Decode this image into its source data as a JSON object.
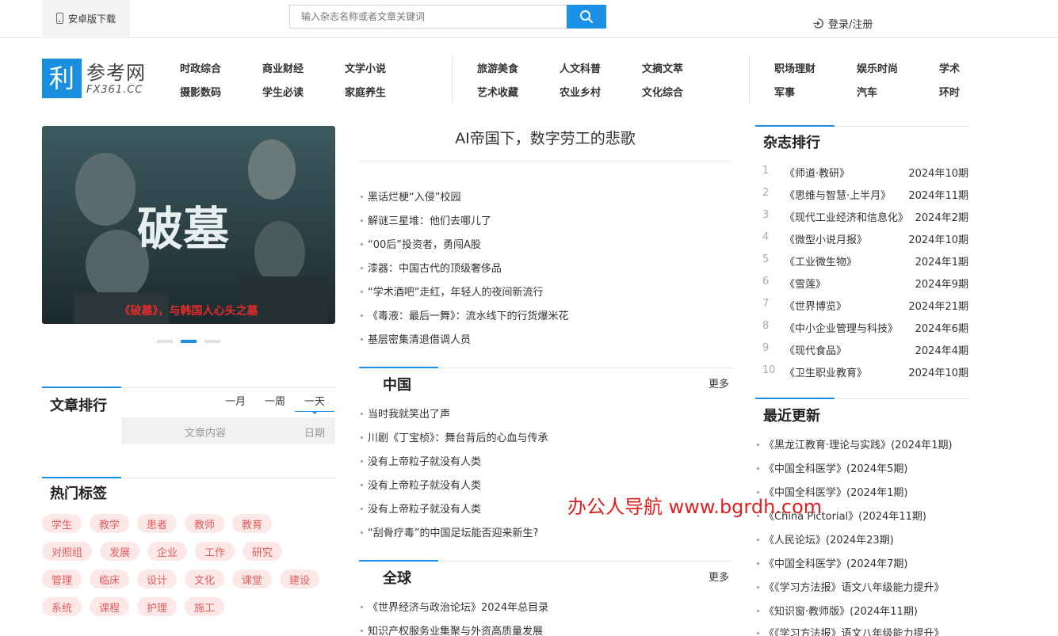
{
  "topbar": {
    "android_label": "安卓版下载",
    "search_placeholder": "输入杂志名称或者文章关键词",
    "login_label": "登录/注册"
  },
  "logo": {
    "icon_text": "利",
    "name": "参考网",
    "domain": "FX361.CC"
  },
  "nav": {
    "group1": [
      "时政综合",
      "商业财经",
      "文学小说",
      "摄影数码",
      "学生必读",
      "家庭养生"
    ],
    "group2": [
      "旅游美食",
      "人文科普",
      "文摘文萃",
      "艺术收藏",
      "农业乡村",
      "文化综合"
    ],
    "group3": [
      "职场理财",
      "娱乐时尚",
      "学术",
      "军事",
      "汽车",
      "环时"
    ]
  },
  "banner": {
    "title_art": "破墓",
    "caption": "《破墓》，与韩国人心头之墓",
    "dot_count": 3,
    "active_dot": 1
  },
  "article_rank": {
    "title": "文章排行",
    "tabs": [
      "一月",
      "一周",
      "一天"
    ],
    "active_tab": 2,
    "col_content": "文章内容",
    "col_date": "日期"
  },
  "hot_tags": {
    "title": "热门标签",
    "tags": [
      "学生",
      "教学",
      "患者",
      "教师",
      "教育",
      "对照组",
      "发展",
      "企业",
      "工作",
      "研究",
      "管理",
      "临床",
      "设计",
      "文化",
      "课堂",
      "建设",
      "系统",
      "课程",
      "护理",
      "施工"
    ]
  },
  "featured": {
    "headline": "AI帝国下，数字劳工的悲歌",
    "items": [
      "黑话烂梗“入侵”校园",
      "解谜三星堆：他们去哪儿了",
      "“00后”投资者，勇闯A股",
      "漆器：中国古代的顶级奢侈品",
      "“学术酒吧”走红，年轻人的夜间新流行",
      "《毒液：最后一舞》：流水线下的行货爆米花",
      "基层密集清退借调人员"
    ]
  },
  "china": {
    "title": "中国",
    "more": "更多",
    "items": [
      "当时我就笑出了声",
      "川剧《丁宝桢》：舞台背后的心血与传承",
      "没有上帝粒子就没有人类",
      "没有上帝粒子就没有人类",
      "没有上帝粒子就没有人类",
      "“刮骨疗毒”的中国足坛能否迎来新生?"
    ]
  },
  "global": {
    "title": "全球",
    "more": "更多",
    "items": [
      "《世界经济与政治论坛》2024年总目录",
      "知识产权服务业集聚与外资高质量发展"
    ]
  },
  "magazine_rank": {
    "title": "杂志排行",
    "rows": [
      {
        "num": "1",
        "name": "《师道·教研》",
        "date": "2024年10期"
      },
      {
        "num": "2",
        "name": "《思维与智慧·上半月》",
        "date": "2024年11期"
      },
      {
        "num": "3",
        "name": "《现代工业经济和信息化》",
        "date": "2024年2期"
      },
      {
        "num": "4",
        "name": "《微型小说月报》",
        "date": "2024年10期"
      },
      {
        "num": "5",
        "name": "《工业微生物》",
        "date": "2024年1期"
      },
      {
        "num": "6",
        "name": "《雪莲》",
        "date": "2024年9期"
      },
      {
        "num": "7",
        "name": "《世界博览》",
        "date": "2024年21期"
      },
      {
        "num": "8",
        "name": "《中小企业管理与科技》",
        "date": "2024年6期"
      },
      {
        "num": "9",
        "name": "《现代食品》",
        "date": "2024年4期"
      },
      {
        "num": "10",
        "name": "《卫生职业教育》",
        "date": "2024年10期"
      }
    ]
  },
  "recent": {
    "title": "最近更新",
    "items": [
      "《黑龙江教育·理论与实践》(2024年1期)",
      "《中国全科医学》(2024年5期)",
      "《中国全科医学》(2024年1期)",
      "《China Pictorial》(2024年11期)",
      "《人民论坛》(2024年23期)",
      "《中国全科医学》(2024年7期)",
      "《《学习方法报》语文八年级能力提升》",
      "《知识窗·教师版》(2024年11期)",
      "《《学习方法报》语文八年级能力提升》"
    ]
  },
  "watermark": "办公人导航 www.bgrdh.com",
  "colors": {
    "accent": "#1a90e6",
    "tag_bg": "#fde8e8",
    "tag_text": "#e55b5b",
    "watermark": "#e02020"
  }
}
